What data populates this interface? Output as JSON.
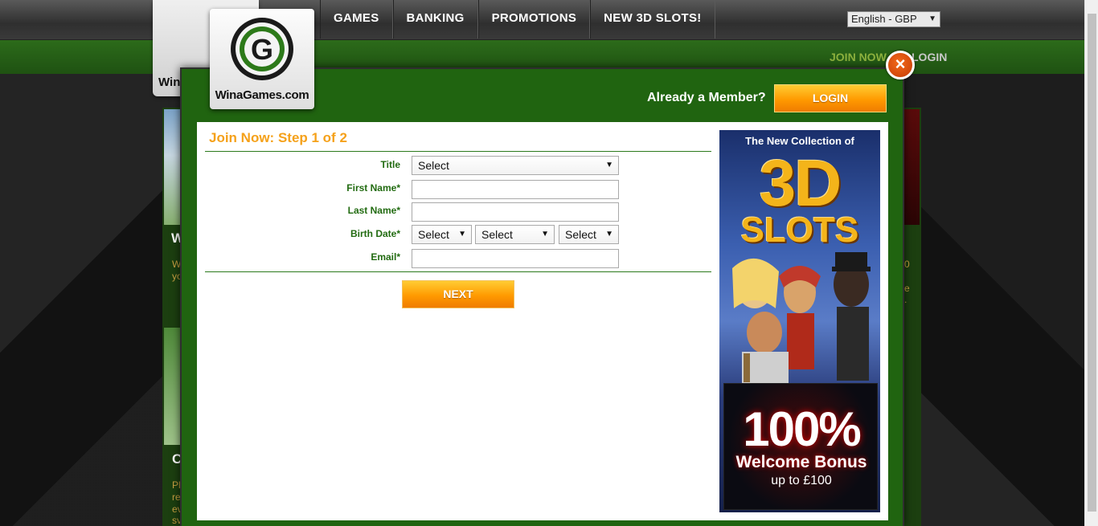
{
  "nav": {
    "items": [
      "GAMES",
      "BANKING",
      "PROMOTIONS",
      "NEW 3D SLOTS!"
    ],
    "language": "English - GBP"
  },
  "background": {
    "logo_text": "Win",
    "join_now": "JOIN NOW",
    "login": "LOGIN",
    "fragments": [
      "W",
      "W",
      "yo",
      "C",
      "Pl",
      "re",
      "ev",
      "sv",
      "0",
      "e",
      "."
    ]
  },
  "modal": {
    "logo_text": "WinaGames.com",
    "close_label": "×",
    "already_member": "Already a Member?",
    "login_button": "LOGIN",
    "step_title": "Join Now: Step 1 of 2",
    "fields": {
      "title_label": "Title",
      "title_value": "Select",
      "first_name_label": "First Name*",
      "last_name_label": "Last Name*",
      "birth_date_label": "Birth Date*",
      "birth_day": "Select",
      "birth_month": "Select",
      "birth_year": "Select",
      "email_label": "Email*"
    },
    "next_button": "NEXT",
    "banner": {
      "headline": "The New Collection of",
      "big": "3D",
      "slots": "SLOTS",
      "percent": "100%",
      "welcome": "Welcome Bonus",
      "upto": "up to £100"
    }
  },
  "colors": {
    "brand_green": "#206410",
    "accent_orange": "#ff9a00",
    "title_orange": "#f5a11a",
    "label_green": "#226b11"
  }
}
